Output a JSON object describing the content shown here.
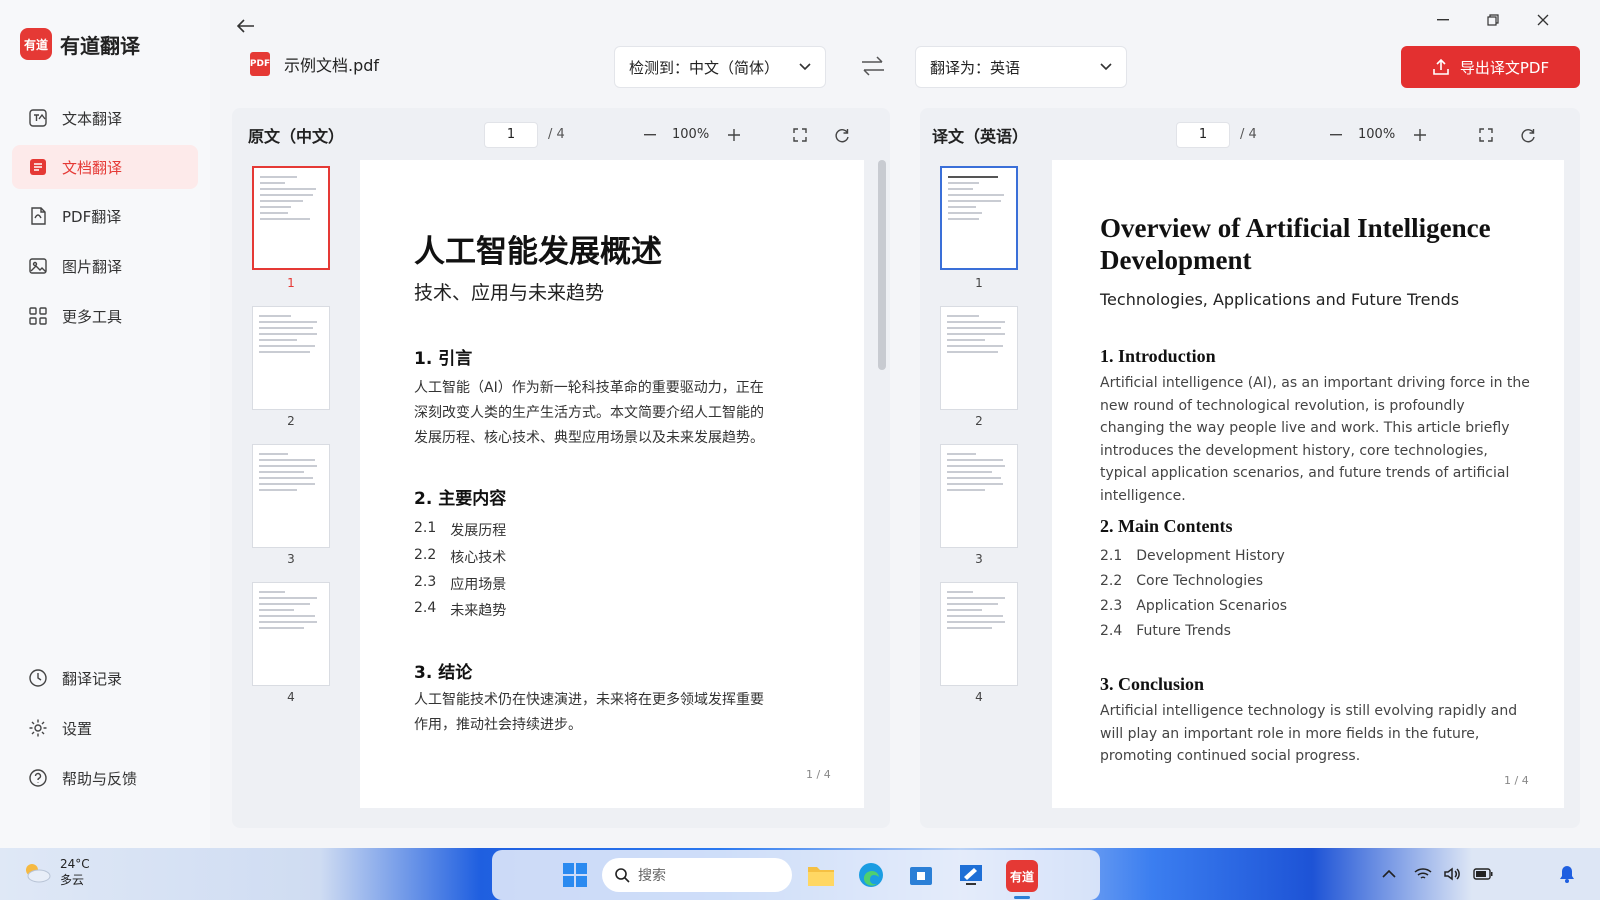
{
  "app": {
    "logo_mark": "有道",
    "title": "有道翻译"
  },
  "sidebar": {
    "items": [
      {
        "label": "文本翻译",
        "icon": "text-translate-icon"
      },
      {
        "label": "文档翻译",
        "icon": "document-translate-icon",
        "active": true
      },
      {
        "label": "PDF翻译",
        "icon": "pdf-icon"
      },
      {
        "label": "图片翻译",
        "icon": "image-icon"
      },
      {
        "label": "更多工具",
        "icon": "grid-icon"
      }
    ],
    "bottom": [
      {
        "label": "翻译记录",
        "icon": "clock-icon"
      },
      {
        "label": "设置",
        "icon": "gear-icon"
      },
      {
        "label": "帮助与反馈",
        "icon": "help-icon"
      }
    ]
  },
  "header": {
    "pdf_badge": "PDF",
    "file_name": "示例文档.pdf",
    "detect_label": "检测到：中文（简体）",
    "target_label": "翻译为：英语",
    "export_label": "导出译文PDF"
  },
  "source_panel": {
    "title": "原文（中文）",
    "page": "1",
    "total": "/ 4",
    "zoom": "100%",
    "thumbs": [
      "1",
      "2",
      "3",
      "4"
    ],
    "doc": {
      "title": "人工智能发展概述",
      "subtitle": "技术、应用与未来趋势",
      "s1_heading": "1.  引言",
      "s1_lines": [
        "人工智能（AI）作为新一轮科技革命的重要驱动力，正在",
        "深刻改变人类的生产生活方式。本文简要介绍人工智能的",
        "发展历程、核心技术、典型应用场景以及未来发展趋势。"
      ],
      "s2_heading": "2.  主要内容",
      "toc": [
        {
          "num": "2.1",
          "text": "发展历程"
        },
        {
          "num": "2.2",
          "text": "核心技术"
        },
        {
          "num": "2.3",
          "text": "应用场景"
        },
        {
          "num": "2.4",
          "text": "未来趋势"
        }
      ],
      "s3_heading": "3.  结论",
      "s3_lines": [
        "人工智能技术仍在快速演进，未来将在更多领域发挥重要",
        "作用，推动社会持续进步。"
      ],
      "footer": "1 / 4"
    }
  },
  "target_panel": {
    "title": "译文（英语）",
    "page": "1",
    "total": "/ 4",
    "zoom": "100%",
    "thumbs": [
      "1",
      "2",
      "3",
      "4"
    ],
    "doc": {
      "title": "Overview of Artificial Intelligence Development",
      "subtitle": "Technologies, Applications and Future Trends",
      "s1_heading": "1.  Introduction",
      "s1_text": "Artificial intelligence (AI), as an important driving force in the new round of technological revolution, is profoundly changing the way people live and work. This article briefly introduces the development history, core technologies, typical application scenarios, and future trends of artificial intelligence.",
      "s2_heading": "2.  Main Contents",
      "toc": [
        {
          "num": "2.1",
          "text": "Development History"
        },
        {
          "num": "2.2",
          "text": "Core Technologies"
        },
        {
          "num": "2.3",
          "text": "Application Scenarios"
        },
        {
          "num": "2.4",
          "text": "Future Trends"
        }
      ],
      "s3_heading": "3.  Conclusion",
      "s3_text": "Artificial intelligence technology is still evolving rapidly and will play an important role in more fields in the future, promoting continued social progress.",
      "footer": "1 / 4"
    }
  },
  "taskbar": {
    "temp": "24°C",
    "weather": "多云",
    "search_placeholder": "搜索",
    "youdao_app": "有道"
  },
  "colors": {
    "accent": "#e53935",
    "export": "#e33030",
    "selected_blue": "#3a6fd8"
  }
}
